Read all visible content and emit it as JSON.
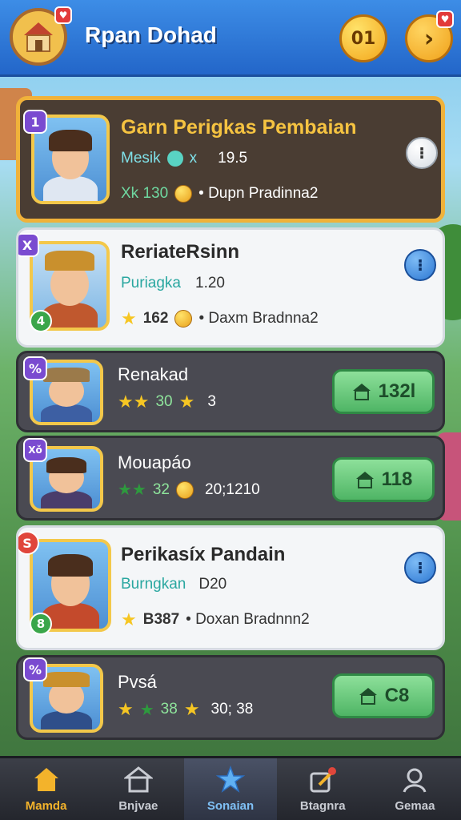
{
  "header": {
    "title": "Rpan Dohad",
    "coin_label": "01",
    "home_icon": "house-icon",
    "next_icon": "chevron-right-icon"
  },
  "colors": {
    "accent": "#2366c9",
    "gold": "#f0b23a",
    "buy_green": "#4fb565"
  },
  "cards": [
    {
      "name": "Garn Perigkas Pembaian",
      "rank": "1",
      "line1_label": "Mesik",
      "line1_icon": "gem-icon",
      "line1_suffix": "x",
      "line1_value": "19.5",
      "line2_prefix": "Xk 130",
      "line2_text": "• Dupn Pradinna2"
    },
    {
      "name": "ReriateRsinn",
      "rank": "X",
      "level": "4",
      "line1_label": "Puriagka",
      "line1_value": "1.20",
      "line2_prefix": "162",
      "line2_text": "• Daxm Bradnna2"
    },
    {
      "name": "Renakad",
      "rank": "%",
      "line1_prefix": "30",
      "line1_value": "3",
      "buy_label": "132l"
    },
    {
      "name": "Mouapáo",
      "rank": "Xǒ",
      "line1_prefix": "32",
      "line1_value": "20;1210",
      "buy_label": "118"
    },
    {
      "name": "Perikasíx Pandain",
      "rank": "S",
      "level": "8",
      "line1_label": "Burngkan",
      "line1_value": "D20",
      "line2_prefix": "B387",
      "line2_text": "• Doxan Bradnnn2"
    },
    {
      "name": "Pvsá",
      "rank": "%",
      "line1_prefix": "38",
      "line1_value": "30; 38",
      "buy_label": "C8"
    }
  ],
  "nav": [
    {
      "label": "Mamda",
      "icon": "home-icon"
    },
    {
      "label": "Bnjvae",
      "icon": "shop-icon"
    },
    {
      "label": "Sonaian",
      "icon": "star-icon"
    },
    {
      "label": "Btagnra",
      "icon": "edit-icon"
    },
    {
      "label": "Gemaa",
      "icon": "profile-icon"
    }
  ]
}
